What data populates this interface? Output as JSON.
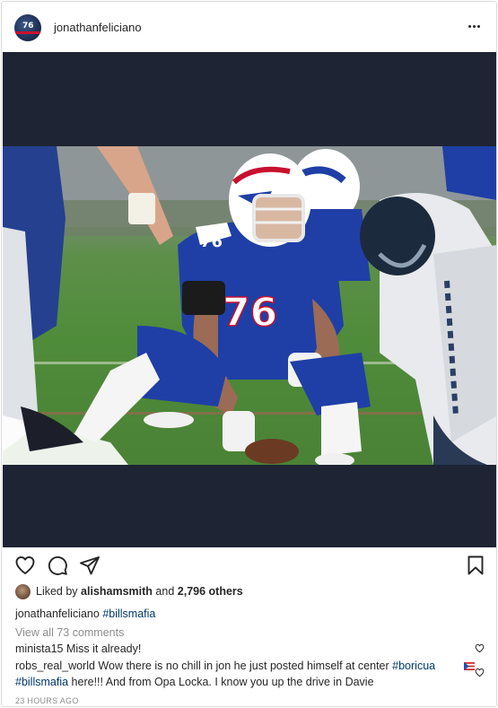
{
  "post": {
    "author": "jonathanfeliciano",
    "avatar_jersey_number": "76",
    "more_icon": "more-horizontal-icon"
  },
  "media": {
    "jersey_number": "76",
    "helmet_brand": "BILLS"
  },
  "actions": {
    "icons": [
      "heart-icon",
      "comment-icon",
      "share-icon",
      "bookmark-icon"
    ]
  },
  "likes": {
    "prefix": "Liked by ",
    "liker": "alishamsmith",
    "middle": " and ",
    "others": "2,796 others"
  },
  "caption": {
    "user": "jonathanfeliciano",
    "hashtag": "#billsmafia"
  },
  "comments_link": "View all 73 comments",
  "comments": [
    {
      "user": "minista15",
      "text": "Miss it already!"
    },
    {
      "user": "robs_real_world",
      "text": "Wow there is no chill in jon he just posted himself at center",
      "hashtag1": "#boricua",
      "hashtag2": "#billsmafia",
      "text2": "here!!! And from Opa Locka. I know you up the drive in Davie"
    }
  ],
  "timestamp": "23 HOURS AGO",
  "colors": {
    "text": "#262626",
    "muted": "#8e8e8e",
    "hashtag": "#00376b",
    "media_background": "#1e2433",
    "bills_blue": "#1f3fa6",
    "bills_red": "#c8102e"
  }
}
